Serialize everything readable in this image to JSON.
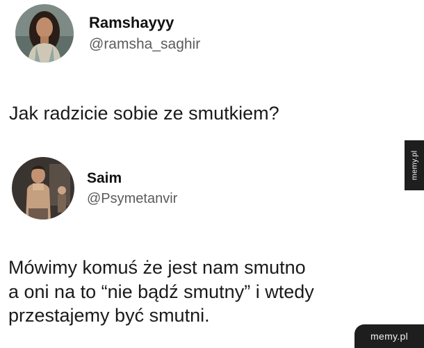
{
  "tweets": [
    {
      "display_name": "Ramshayyy",
      "handle": "@ramsha_saghir",
      "text": "Jak radzicie sobie ze smutkiem?"
    },
    {
      "display_name": "Saim",
      "handle": "@Psymetanvir",
      "text_lines": [
        "Mówimy komuś że jest nam smutno",
        "a oni na to “nie bądź smutny” i wtedy",
        "przestajemy być smutni."
      ]
    }
  ],
  "watermarks": {
    "side": "memy.pl",
    "corner": "memy.pl"
  }
}
